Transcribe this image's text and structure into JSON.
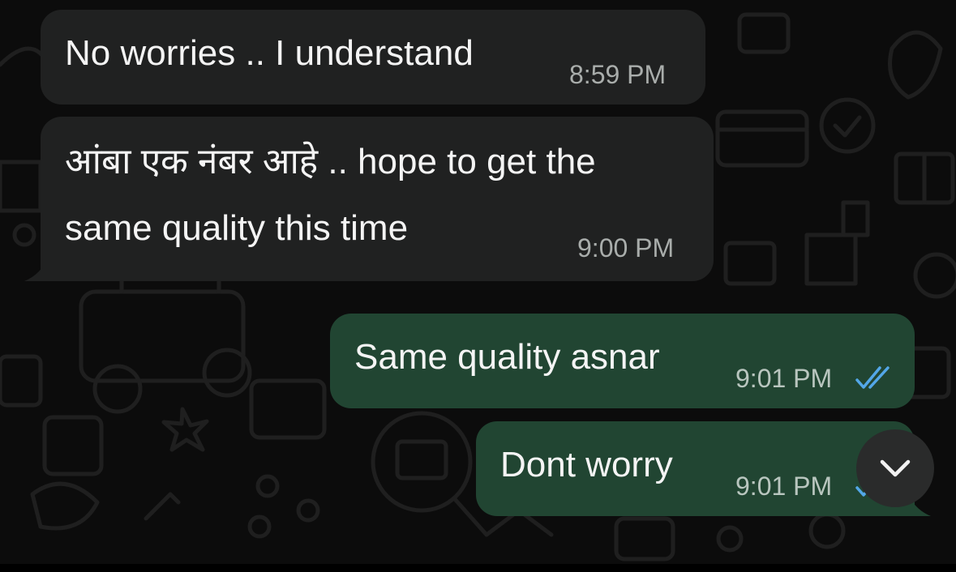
{
  "messages": [
    {
      "direction": "incoming",
      "text": "No worries .. I understand",
      "time": "8:59 PM"
    },
    {
      "direction": "incoming",
      "line1": "आंबा एक नंबर आहे .. hope to get the",
      "line2": "same quality this time",
      "time": "9:00 PM"
    },
    {
      "direction": "outgoing",
      "text": "Same quality asnar",
      "time": "9:01 PM",
      "status_icon": "double-check-read-icon"
    },
    {
      "direction": "outgoing",
      "text": "Dont worry",
      "time": "9:01 PM",
      "status_icon": "double-check-read-icon"
    }
  ],
  "scroll_button": {
    "icon": "chevron-down-icon"
  },
  "colors": {
    "background": "#0c0c0c",
    "incoming_bubble": "#202121",
    "outgoing_bubble": "#214532",
    "read_check": "#53a7e8"
  }
}
